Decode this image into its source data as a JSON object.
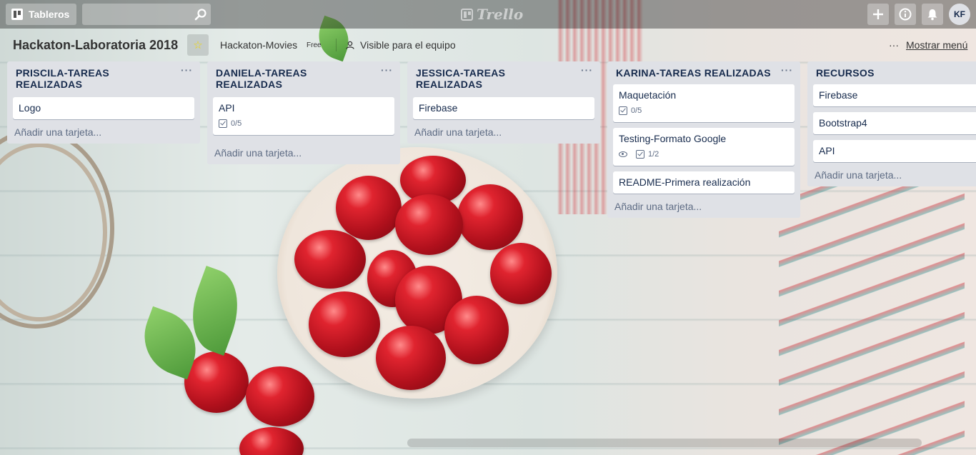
{
  "header": {
    "boards_label": "Tableros",
    "search_value": "",
    "logo_text": "Trello",
    "avatar_initials": "KF",
    "icons": [
      "boards-icon",
      "search-icon",
      "plus-icon",
      "info-icon",
      "bell-icon"
    ]
  },
  "board": {
    "title": "Hackaton-Laboratoria 2018",
    "team": "Hackaton-Movies",
    "team_badge": "Free",
    "visibility": "Visible para el equipo",
    "show_menu": "Mostrar menú",
    "star_color": "#f2d600"
  },
  "lists": [
    {
      "title": "PRISCILA-TAREAS REALIZADAS",
      "cards": [
        {
          "title": "Logo"
        }
      ],
      "add_card": "Añadir una tarjeta..."
    },
    {
      "title": "DANIELA-TAREAS REALIZADAS",
      "cards": [
        {
          "title": "API",
          "checklist": "0/5"
        }
      ],
      "add_card": "Añadir una tarjeta..."
    },
    {
      "title": "JESSICA-TAREAS REALIZADAS",
      "cards": [
        {
          "title": "Firebase"
        }
      ],
      "add_card": "Añadir una tarjeta..."
    },
    {
      "title": "KARINA-TAREAS REALIZADAS",
      "cards": [
        {
          "title": "Maquetación",
          "checklist": "0/5"
        },
        {
          "title": "Testing-Formato Google",
          "watched": true,
          "checklist": "1/2"
        },
        {
          "title": "README-Primera realización"
        }
      ],
      "add_card": "Añadir una tarjeta..."
    },
    {
      "title": "RECURSOS",
      "cards": [
        {
          "title": "Firebase"
        },
        {
          "title": "Bootstrap4"
        },
        {
          "title": "API"
        }
      ],
      "add_card": "Añadir una tarjeta..."
    }
  ]
}
